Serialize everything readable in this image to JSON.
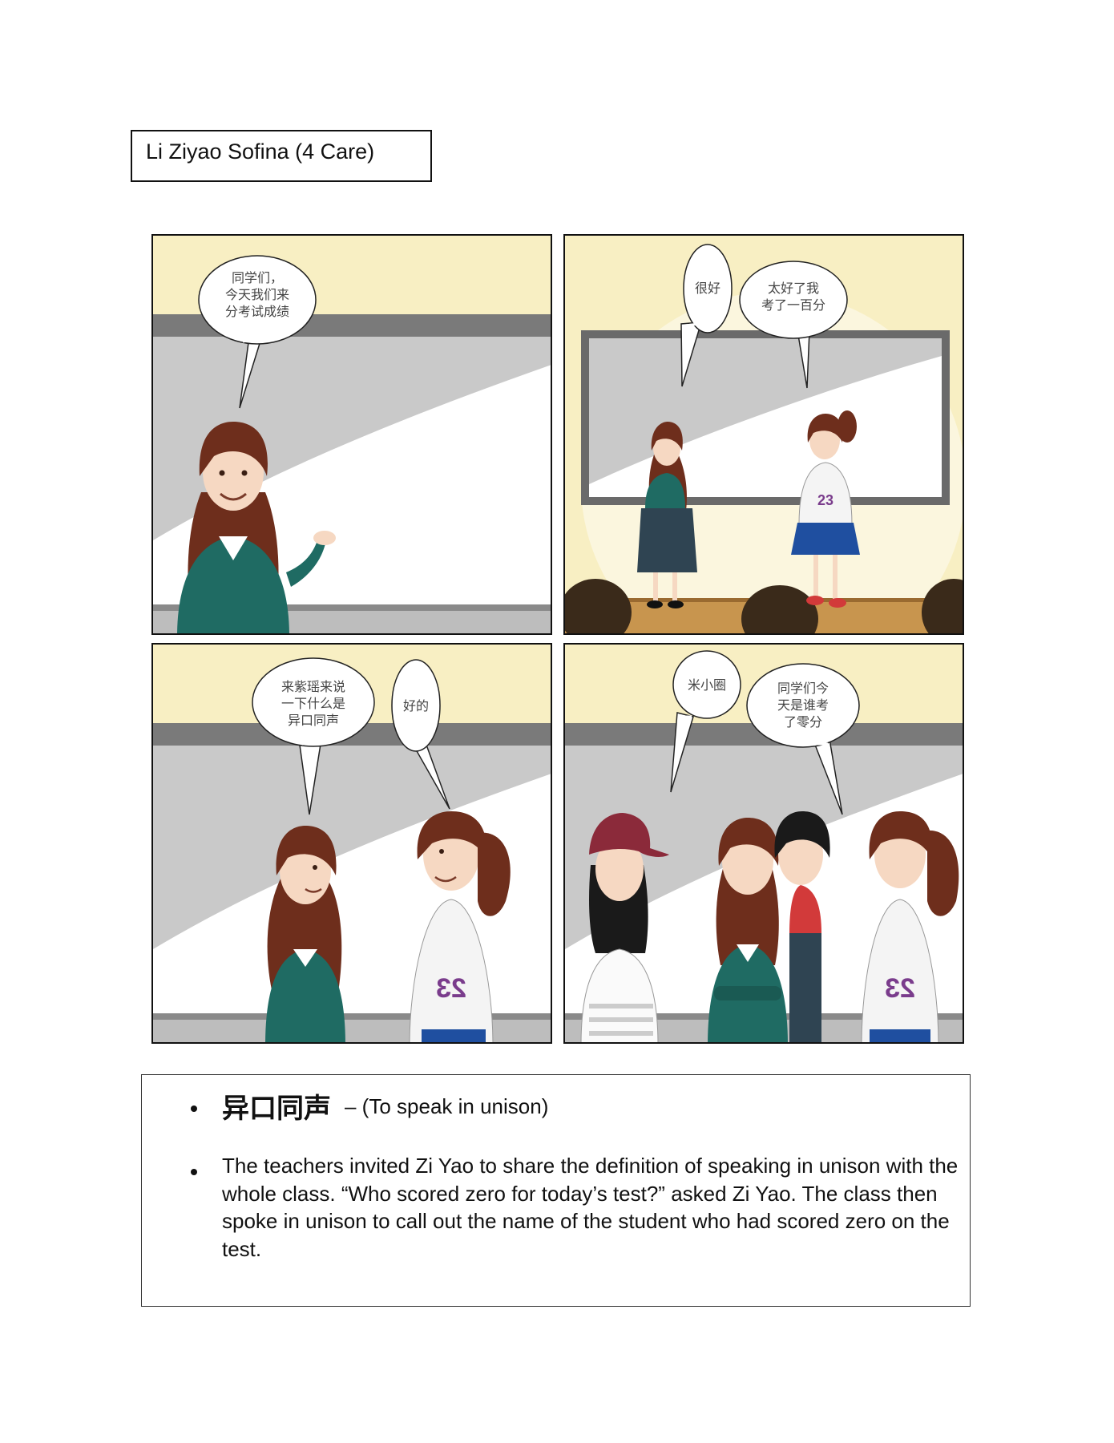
{
  "author_label": "Li Ziyao Sofina (4 Care)",
  "panels": [
    {
      "id": "panel-1",
      "bubbles": [
        {
          "text": "同学们，\n今天我们来\n分考试成绩"
        }
      ]
    },
    {
      "id": "panel-2",
      "bubbles": [
        {
          "text": "很好"
        },
        {
          "text": "太好了我\n考了一百分"
        }
      ]
    },
    {
      "id": "panel-3",
      "bubbles": [
        {
          "text": "来紫瑶来说\n一下什么是\n异口同声"
        },
        {
          "text": "好的"
        }
      ]
    },
    {
      "id": "panel-4",
      "bubbles": [
        {
          "text": "米小圈"
        },
        {
          "text": "同学们今\n天是谁考\n了零分"
        }
      ]
    }
  ],
  "notes": {
    "idiom": "异口同声",
    "idiom_meaning": "– (To speak in unison)",
    "description": "The teachers invited Zi Yao to share the definition of speaking in unison with the whole class. “Who scored zero for today’s test?” asked Zi Yao. The class then spoke in unison to call out the name of the student who had scored zero on the test."
  },
  "shirt_number": "23",
  "colors": {
    "wall": "#f8efc3",
    "board_frame": "#777777",
    "board_gray": "#c8c8c8",
    "sweater": "#1f6b63",
    "hair": "#6e2e1c",
    "skin": "#f6d8c2",
    "cap": "#8b2a3a"
  }
}
